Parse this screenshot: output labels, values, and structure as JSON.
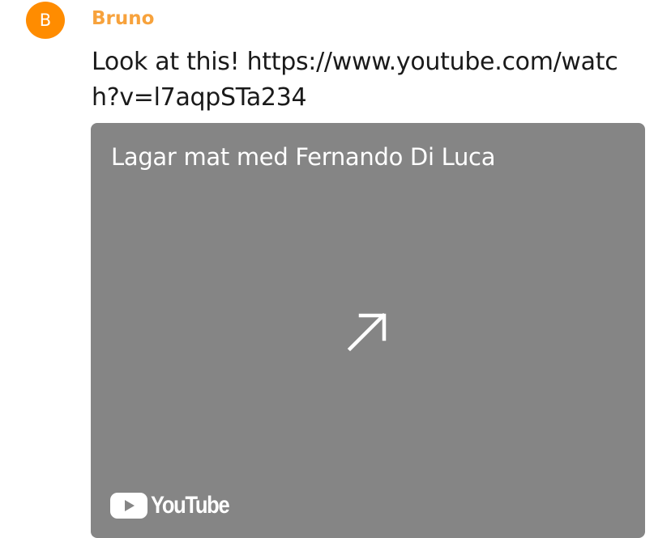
{
  "message": {
    "avatar_initial": "B",
    "sender": "Bruno",
    "text": "Look at this! https://www.youtube.com/watch?v=l7aqpSTa234"
  },
  "link_preview": {
    "title": "Lagar mat med Fernando Di Luca",
    "open_icon": "arrow-up-right-icon",
    "provider": "YouTube",
    "provider_icon": "youtube-play-icon",
    "background_color": "#858585"
  },
  "colors": {
    "avatar": "#ff8c00",
    "sender_name": "#f7a23c"
  }
}
